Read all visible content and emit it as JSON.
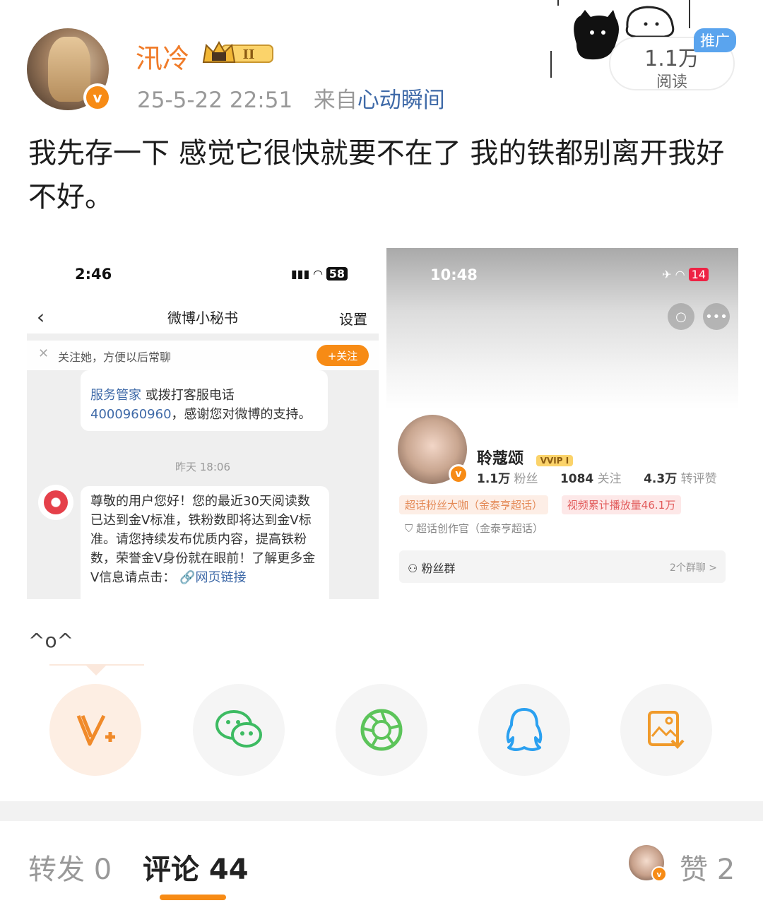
{
  "post": {
    "username": "汛冷",
    "vip_level": "II",
    "timestamp": "25-5-22 22:51",
    "source_prefix": "来自",
    "source": "心动瞬间",
    "reads_count": "1.1万",
    "reads_label": "阅读",
    "promo_label": "推广",
    "text": "我先存一下 感觉它很快就要不在了 我的铁都别离开我好不好。",
    "caption": "^o^"
  },
  "screenshot_left": {
    "time": "2:46",
    "battery": "58",
    "title": "微博小秘书",
    "settings": "设置",
    "follow_prompt": "关注她，方便以后常聊",
    "follow_button": "+关注",
    "msg1_link": "服务管家",
    "msg1_text_a": " 或拨打客服电话",
    "msg1_phone": "4000960960",
    "msg1_text_b": "，感谢您对微博的支持。",
    "timestamp": "昨天 18:06",
    "msg2_text": "尊敬的用户您好！您的最近30天阅读数已达到金V标准，铁粉数即将达到金V标准。请您持续发布优质内容，提高铁粉数，荣誉金V身份就在眼前！了解更多金V信息请点击：",
    "msg2_link": "网页链接"
  },
  "screenshot_right": {
    "time": "10:48",
    "battery": "14",
    "name": "聆蔻颂",
    "vvip": "VVIP I",
    "fans_num": "1.1万",
    "fans_label": "粉丝",
    "follow_num": "1084",
    "follow_label": "关注",
    "likes_num": "4.3万",
    "likes_label": "转评赞",
    "tag1": "超话粉丝大咖（金泰亨超话）",
    "tag2": "视频累计播放量46.1万",
    "creator": "超话创作官（金泰亨超话）",
    "fan_group": "粉丝群",
    "fan_group_count": "2个群聊 >"
  },
  "share": {
    "items": [
      "v-plus-icon",
      "wechat-icon",
      "moments-icon",
      "qq-icon",
      "save-image-icon"
    ]
  },
  "tabs": {
    "repost": "转发 0",
    "comments": "评论 44",
    "likes": "赞 2"
  },
  "colors": {
    "accent": "#f78b15",
    "link": "#3f6aa8",
    "username": "#f07c2a"
  }
}
